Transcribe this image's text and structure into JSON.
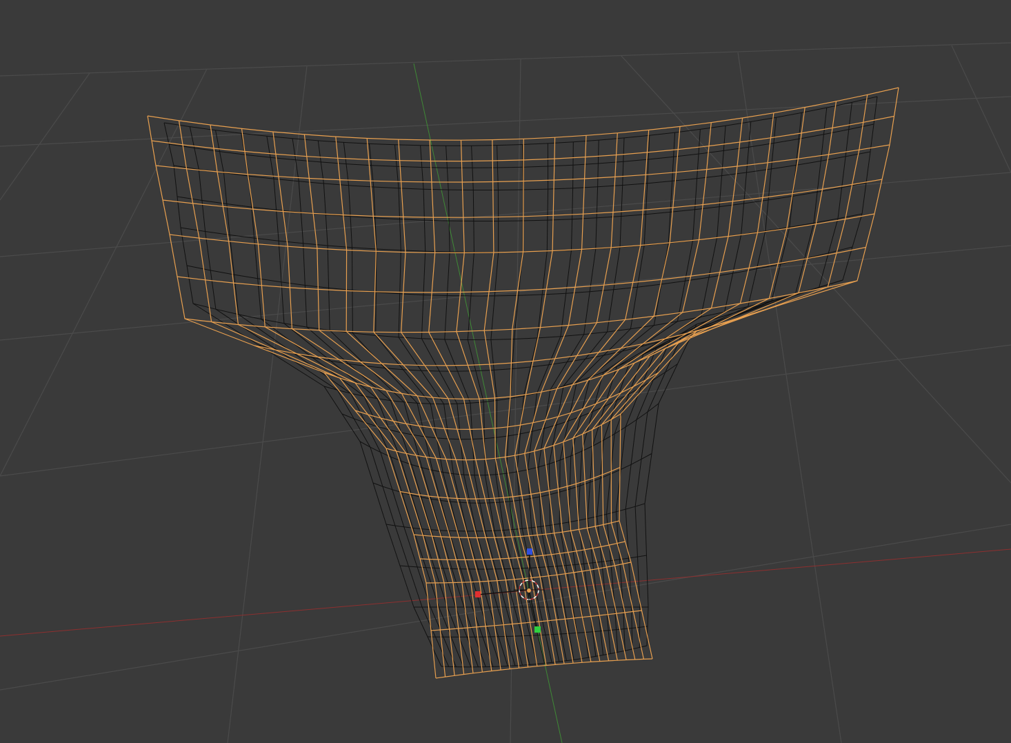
{
  "viewport": {
    "name": "3d-viewport",
    "colors": {
      "background": "#3a3a3a",
      "floor_grid": "#4b4b4b",
      "x_axis": "#8e2f2f",
      "y_axis": "#3f8a36",
      "mesh_edge": "#111111",
      "cage_edge": "#e8a050",
      "cage_edge_bright": "#f2b060",
      "cursor_ring_a": "#ffffff",
      "cursor_ring_b": "#c23a3a",
      "gizmo_x": "#e03030",
      "gizmo_y": "#30d040",
      "gizmo_z": "#3050e0",
      "origin_dot": "#e8a050"
    },
    "icons": {
      "cursor": "3d-cursor-icon",
      "gizmo": "transform-gizmo-icon"
    }
  }
}
